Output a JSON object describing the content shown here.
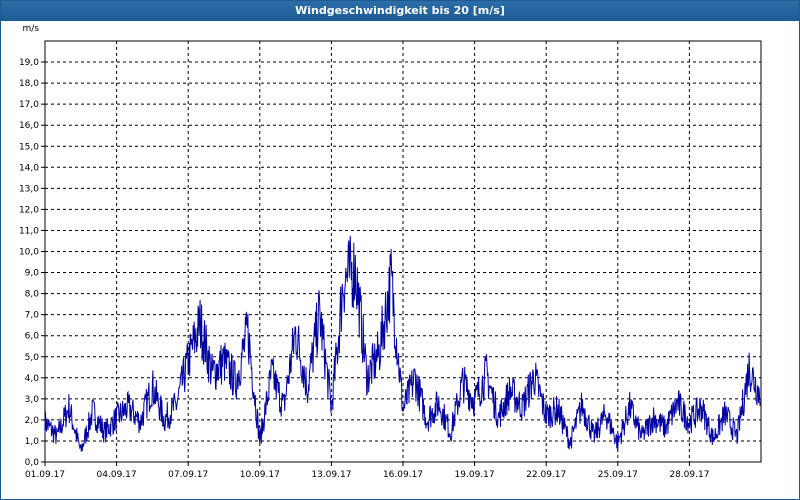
{
  "window": {
    "title": "Windgeschwindigkeit bis 20 [m/s]"
  },
  "colors": {
    "title_bar": "#1f5b92",
    "series": "#0000a0",
    "grid": "#000000",
    "background": "#ffffff"
  },
  "chart_data": {
    "type": "line",
    "title": "Windgeschwindigkeit bis 20 [m/s]",
    "ylabel": "m/s",
    "xlabel": "",
    "ylim": [
      0,
      20
    ],
    "xlim": [
      "2017-09-01",
      "2017-10-01"
    ],
    "grid": true,
    "legend": "none",
    "x_tick_labels": [
      "01.09.17",
      "04.09.17",
      "07.09.17",
      "10.09.17",
      "13.09.17",
      "16.09.17",
      "19.09.17",
      "22.09.17",
      "25.09.17",
      "28.09.17"
    ],
    "y_tick_labels": [
      "0,0",
      "1,0",
      "2,0",
      "3,0",
      "4,0",
      "5,0",
      "6,0",
      "7,0",
      "8,0",
      "9,0",
      "10,0",
      "11,0",
      "12,0",
      "13,0",
      "14,0",
      "15,0",
      "16,0",
      "17,0",
      "18,0",
      "19,0"
    ],
    "series": [
      {
        "x": [
          "2017-09-01 00:00",
          "2017-09-01 12:00",
          "2017-09-02 00:00",
          "2017-09-02 12:00",
          "2017-09-03 00:00",
          "2017-09-03 12:00",
          "2017-09-04 00:00",
          "2017-09-04 12:00",
          "2017-09-05 00:00",
          "2017-09-05 12:00",
          "2017-09-06 00:00",
          "2017-09-06 12:00",
          "2017-09-07 00:00",
          "2017-09-07 12:00",
          "2017-09-08 00:00",
          "2017-09-08 12:00",
          "2017-09-09 00:00",
          "2017-09-09 12:00",
          "2017-09-10 00:00",
          "2017-09-10 12:00",
          "2017-09-11 00:00",
          "2017-09-11 12:00",
          "2017-09-12 00:00",
          "2017-09-12 12:00",
          "2017-09-13 00:00",
          "2017-09-13 06:00",
          "2017-09-13 12:00",
          "2017-09-14 00:00",
          "2017-09-14 12:00",
          "2017-09-15 00:00",
          "2017-09-15 12:00",
          "2017-09-16 00:00",
          "2017-09-16 12:00",
          "2017-09-17 00:00",
          "2017-09-17 12:00",
          "2017-09-18 00:00",
          "2017-09-18 12:00",
          "2017-09-19 00:00",
          "2017-09-19 12:00",
          "2017-09-20 00:00",
          "2017-09-20 12:00",
          "2017-09-21 00:00",
          "2017-09-21 12:00",
          "2017-09-22 00:00",
          "2017-09-22 12:00",
          "2017-09-23 00:00",
          "2017-09-23 12:00",
          "2017-09-24 00:00",
          "2017-09-24 12:00",
          "2017-09-25 00:00",
          "2017-09-25 12:00",
          "2017-09-26 00:00",
          "2017-09-26 12:00",
          "2017-09-27 00:00",
          "2017-09-27 12:00",
          "2017-09-28 00:00",
          "2017-09-28 12:00",
          "2017-09-29 00:00",
          "2017-09-29 12:00",
          "2017-09-30 00:00",
          "2017-09-30 12:00",
          "2017-09-30 23:00"
        ],
        "y": [
          1.9,
          1.2,
          2.6,
          0.5,
          2.4,
          1.4,
          2.1,
          2.6,
          1.9,
          3.6,
          2.0,
          2.7,
          4.8,
          6.6,
          4.2,
          4.8,
          3.8,
          6.2,
          1.0,
          4.2,
          2.6,
          6.2,
          3.5,
          7.1,
          2.6,
          5.4,
          8.6,
          9.2,
          4.0,
          5.2,
          8.7,
          2.5,
          4.0,
          2.0,
          2.8,
          1.4,
          3.8,
          2.9,
          4.2,
          2.1,
          3.4,
          2.6,
          4.1,
          2.2,
          2.5,
          0.9,
          2.7,
          1.2,
          2.3,
          0.9,
          2.6,
          1.2,
          2.1,
          1.6,
          2.8,
          1.9,
          2.6,
          1.1,
          2.3,
          1.2,
          4.5,
          3.2
        ]
      }
    ]
  }
}
